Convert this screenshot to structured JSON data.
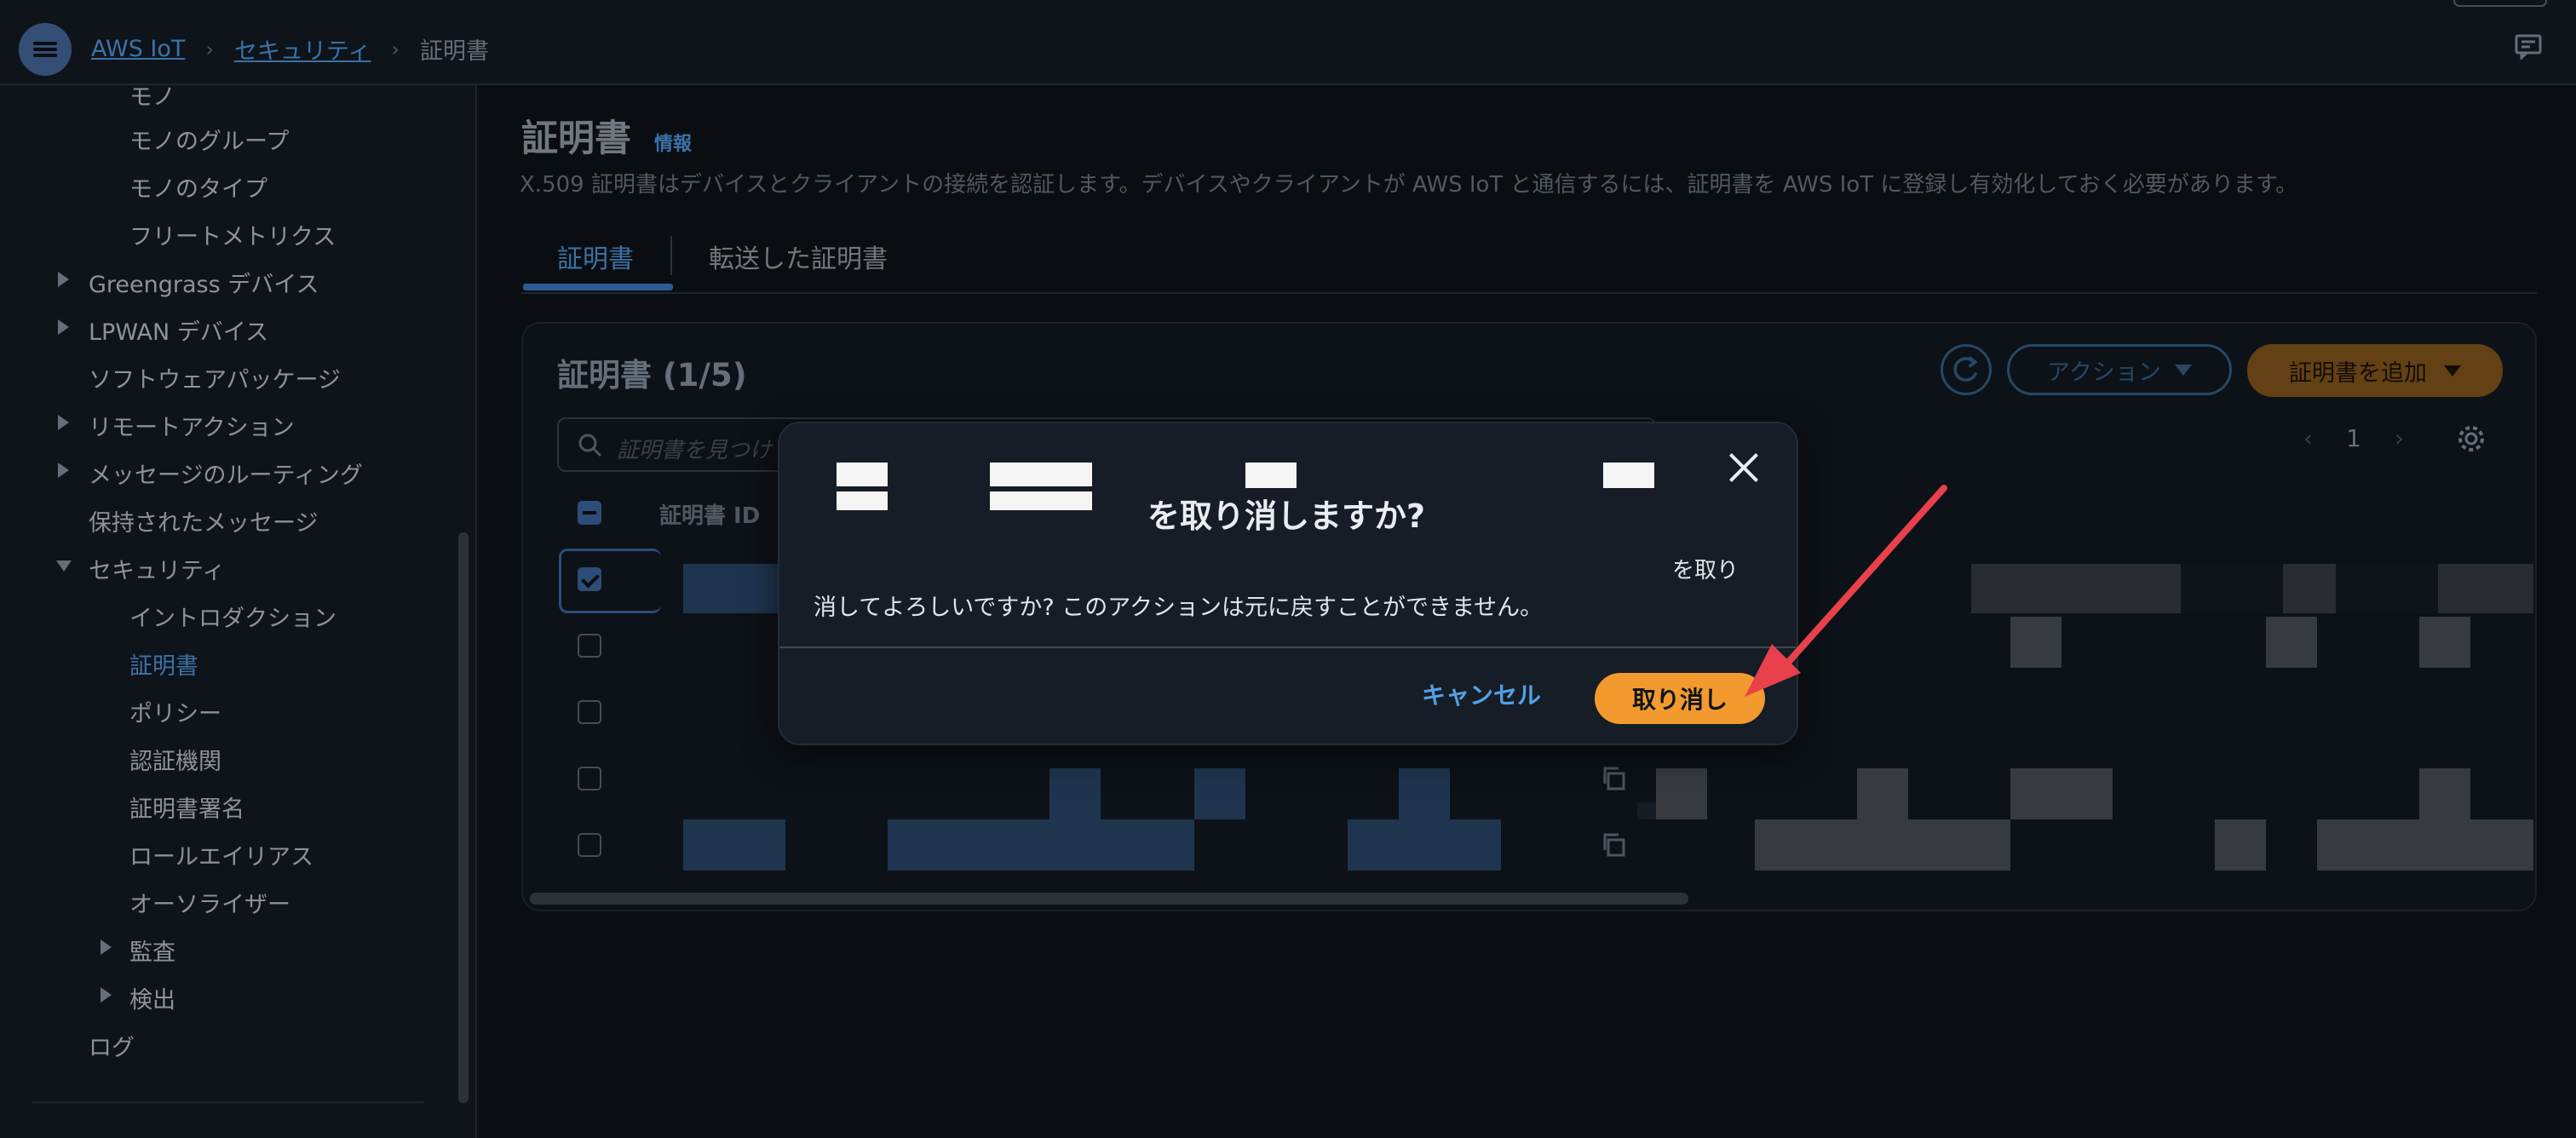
{
  "topbar": {
    "breadcrumb": [
      "AWS IoT",
      "セキュリティ",
      "証明書"
    ]
  },
  "sidebar": {
    "items": [
      {
        "label": "モノ",
        "level": 2
      },
      {
        "label": "モノのグループ",
        "level": 2
      },
      {
        "label": "モノのタイプ",
        "level": 2
      },
      {
        "label": "フリートメトリクス",
        "level": 2
      },
      {
        "label": "Greengrass デバイス",
        "level": 1,
        "caret": "right"
      },
      {
        "label": "LPWAN デバイス",
        "level": 1,
        "caret": "right"
      },
      {
        "label": "ソフトウェアパッケージ",
        "level": 1
      },
      {
        "label": "リモートアクション",
        "level": 1,
        "caret": "right"
      },
      {
        "label": "メッセージのルーティング",
        "level": 1,
        "caret": "right"
      },
      {
        "label": "保持されたメッセージ",
        "level": 1
      },
      {
        "label": "セキュリティ",
        "level": 1,
        "caret": "down"
      },
      {
        "label": "イントロダクション",
        "level": 2
      },
      {
        "label": "証明書",
        "level": 2,
        "active": true
      },
      {
        "label": "ポリシー",
        "level": 2
      },
      {
        "label": "認証機関",
        "level": 2
      },
      {
        "label": "証明書署名",
        "level": 2
      },
      {
        "label": "ロールエイリアス",
        "level": 2
      },
      {
        "label": "オーソライザー",
        "level": 2
      },
      {
        "label": "監査",
        "level": 2,
        "caret": "right"
      },
      {
        "label": "検出",
        "level": 2,
        "caret": "right"
      },
      {
        "label": "ログ",
        "level": 1
      }
    ]
  },
  "page": {
    "title": "証明書",
    "info": "情報",
    "description": "X.509 証明書はデバイスとクライアントの接続を認証します。デバイスやクライアントが AWS IoT と通信するには、証明書を AWS IoT に登録し有効化しておく必要があります。",
    "tabs": [
      "証明書",
      "転送した証明書"
    ]
  },
  "panel": {
    "title": "証明書 (1/5)",
    "actions_label": "アクション",
    "add_label": "証明書を追加",
    "search_placeholder": "証明書を見つけ",
    "page_number": "1",
    "column_cert_id": "証明書 ID",
    "rows": [
      {
        "checked": true
      },
      {
        "checked": false
      },
      {
        "checked": false
      },
      {
        "checked": false
      },
      {
        "checked": false
      }
    ]
  },
  "modal": {
    "title": "を取り消しますか?",
    "title_tail": "を取り",
    "body": "消してよろしいですか? このアクションは元に戻すことができません。",
    "cancel_label": "キャンセル",
    "confirm_label": "取り消し"
  },
  "colors": {
    "accent": "#539fe5",
    "confirm": "#f29a2e",
    "arrow": "#e8414b"
  }
}
